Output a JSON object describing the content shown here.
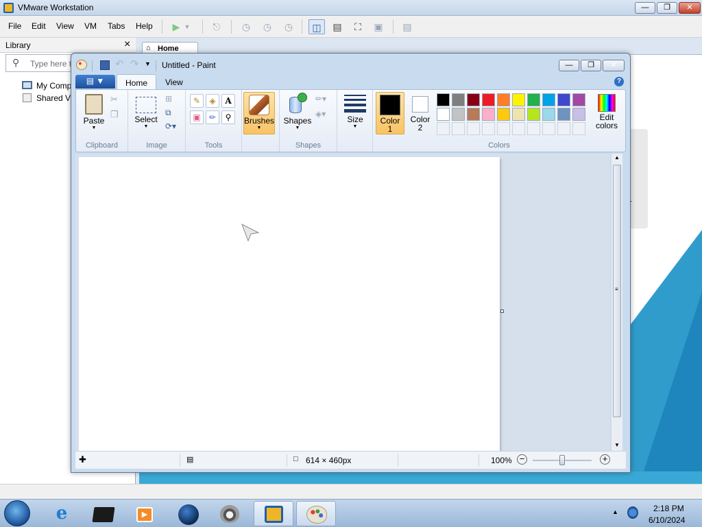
{
  "vmware": {
    "title": "VMware Workstation",
    "menu": [
      "File",
      "Edit",
      "View",
      "VM",
      "Tabs",
      "Help"
    ],
    "library": {
      "title": "Library",
      "close": "×",
      "search_placeholder": "Type here t",
      "items": [
        "My Comp",
        "Shared VI"
      ]
    },
    "home_tab": "Home",
    "partial_text": "r"
  },
  "paint": {
    "title": "Untitled - Paint",
    "tabs": [
      "Home",
      "View"
    ],
    "groups": {
      "clipboard": {
        "label": "Clipboard",
        "paste": "Paste"
      },
      "image": {
        "label": "Image",
        "select": "Select"
      },
      "tools": {
        "label": "Tools",
        "text_tool": "A"
      },
      "brushes": {
        "label": "Brushes"
      },
      "shapes": {
        "label": "Shapes",
        "button": "Shapes"
      },
      "size": {
        "label": "Size"
      },
      "colors": {
        "label": "Colors",
        "color1_line1": "Color",
        "color1_line2": "1",
        "color2_line1": "Color",
        "color2_line2": "2",
        "edit_line1": "Edit",
        "edit_line2": "colors"
      }
    },
    "palette_row1": [
      "#000000",
      "#7f7f7f",
      "#880015",
      "#ed1c24",
      "#ff7f27",
      "#fff200",
      "#22b14c",
      "#00a2e8",
      "#3f48cc",
      "#a349a4"
    ],
    "palette_row2": [
      "#ffffff",
      "#c3c3c3",
      "#b97a57",
      "#ffaec9",
      "#ffc90e",
      "#efe4b0",
      "#b5e61d",
      "#99d9ea",
      "#7092be",
      "#c8bfe7"
    ],
    "color1": "#000000",
    "color2": "#ffffff",
    "status": {
      "image_size": "614 × 460px",
      "zoom": "100%"
    }
  },
  "taskbar": {
    "clock_time": "2:18 PM",
    "clock_date": "6/10/2024"
  },
  "colors": {
    "accent_orange": "#f9c365",
    "ribbon_blue": "#1d4f9a"
  }
}
